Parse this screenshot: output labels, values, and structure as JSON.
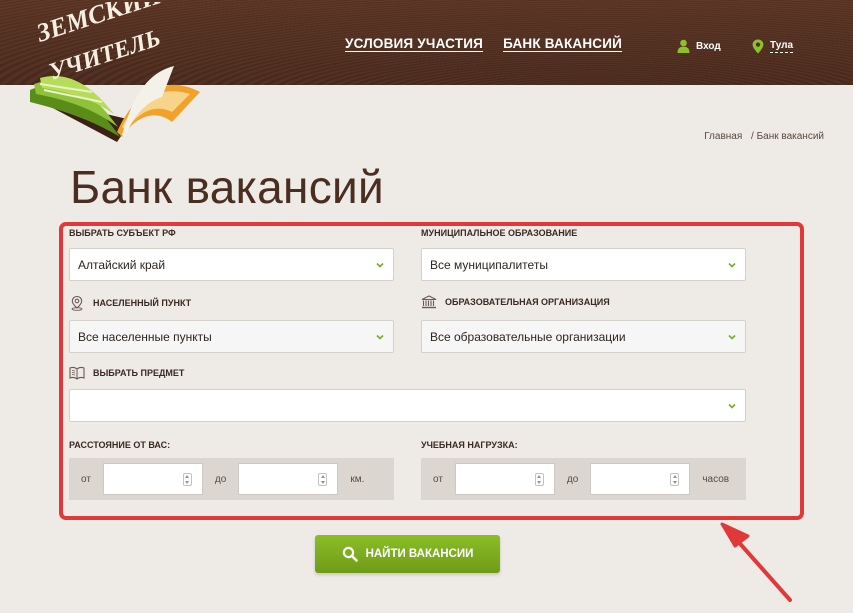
{
  "header": {
    "logo_text_line1": "ЗЕМСКИЙ",
    "logo_text_line2": "УЧИТЕЛЬ",
    "nav": [
      {
        "label": "УСЛОВИЯ УЧАСТИЯ"
      },
      {
        "label": "БАНК ВАКАНСИЙ"
      }
    ],
    "login_label": "Вход",
    "city_label": "Тула"
  },
  "breadcrumb": {
    "home": "Главная",
    "current": "/ Банк вакансий"
  },
  "page_title": "Банк вакансий",
  "filters": {
    "region": {
      "label": "ВЫБРАТЬ СУБЪЕКТ РФ",
      "value": "Алтайский край"
    },
    "municipality": {
      "label": "МУНИЦИПАЛЬНОЕ ОБРАЗОВАНИЕ",
      "value": "Все муниципалитеты"
    },
    "settlement": {
      "label": "НАСЕЛЕННЫЙ ПУНКТ",
      "value": "Все населенные пункты"
    },
    "organization": {
      "label": "ОБРАЗОВАТЕЛЬНАЯ ОРГАНИЗАЦИЯ",
      "value": "Все образовательные организации"
    },
    "subject": {
      "label": "ВЫБРАТЬ ПРЕДМЕТ",
      "value": ""
    },
    "distance": {
      "label": "РАССТОЯНИЕ ОТ ВАС:",
      "from": "от",
      "to": "до",
      "unit": "км."
    },
    "workload": {
      "label": "УЧЕБНАЯ НАГРУЗКА:",
      "from": "от",
      "to": "до",
      "unit": "часов"
    }
  },
  "search_button": "НАЙТИ ВАКАНСИИ",
  "colors": {
    "header_brown": "#4a2a1c",
    "accent_green": "#7aab1e",
    "highlight_red": "#e0393a",
    "background": "#eeeae6"
  }
}
